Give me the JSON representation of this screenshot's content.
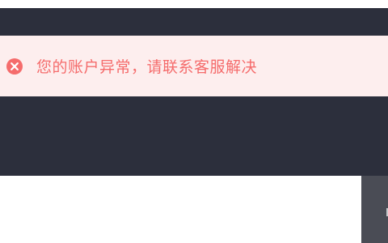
{
  "alert": {
    "icon": "circle-x-icon",
    "message": "您的账户异常，请联系客服解决",
    "color": "#f56c6c",
    "background": "#fdeeee"
  },
  "colors": {
    "header_background": "#2c2f3c",
    "side_panel_background": "#4a4c55"
  }
}
